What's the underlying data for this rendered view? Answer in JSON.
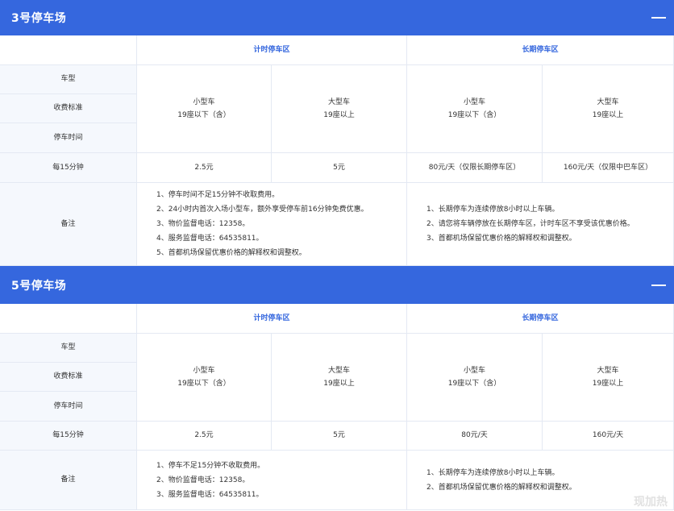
{
  "lots": [
    {
      "title": "3号停车场",
      "zone_timed": "计时停车区",
      "zone_long": "长期停车区",
      "row_labels": [
        "车型",
        "收费标准",
        "停车时间"
      ],
      "cars": [
        {
          "type": "小型车",
          "seats": "19座以下（含）"
        },
        {
          "type": "大型车",
          "seats": "19座以上"
        },
        {
          "type": "小型车",
          "seats": "19座以下（含）"
        },
        {
          "type": "大型车",
          "seats": "19座以上"
        }
      ],
      "rate_label": "每15分钟",
      "rates": [
        "2.5元",
        "5元",
        "80元/天（仅限长期停车区）",
        "160元/天（仅限中巴车区）"
      ],
      "notes_label": "备注",
      "notes_timed": [
        "1、停车时间不足15分钟不收取费用。",
        "2、24小时内首次入场小型车，额外享受停车前16分钟免费优惠。",
        "3、物价监督电话：12358。",
        "4、服务监督电话：64535811。",
        "5、首都机场保留优惠价格的解释权和调整权。"
      ],
      "notes_long": [
        "1、长期停车为连续停放8小时以上车辆。",
        "2、请您将车辆停放在长期停车区，计时车区不享受该优惠价格。",
        "3、首都机场保留优惠价格的解释权和调整权。"
      ]
    },
    {
      "title": "5号停车场",
      "zone_timed": "计时停车区",
      "zone_long": "长期停车区",
      "row_labels": [
        "车型",
        "收费标准",
        "停车时间"
      ],
      "cars": [
        {
          "type": "小型车",
          "seats": "19座以下（含）"
        },
        {
          "type": "大型车",
          "seats": "19座以上"
        },
        {
          "type": "小型车",
          "seats": "19座以下（含）"
        },
        {
          "type": "大型车",
          "seats": "19座以上"
        }
      ],
      "rate_label": "每15分钟",
      "rates": [
        "2.5元",
        "5元",
        "80元/天",
        "160元/天"
      ],
      "notes_label": "备注",
      "notes_timed": [
        "1、停车不足15分钟不收取费用。",
        "2、物价监督电话：12358。",
        "3、服务监督电话：64535811。"
      ],
      "notes_long": [
        "1、长期停车为连续停放8小时以上车辆。",
        "2、首都机场保留优惠价格的解释权和调整权。"
      ]
    }
  ],
  "watermark": "现加热",
  "colors": {
    "header": "#3567de",
    "label_bg": "#f5f8fd",
    "zone_text": "#3567de"
  }
}
